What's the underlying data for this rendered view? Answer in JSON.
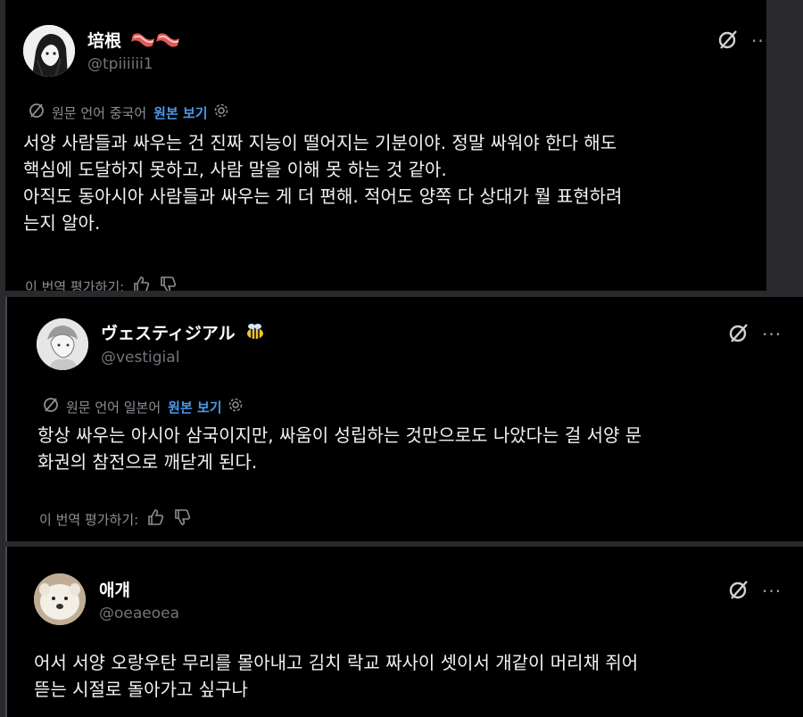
{
  "posts": [
    {
      "author": "培根",
      "handle": "@tpiiiiii1",
      "translation_note": "원문 언어 중국어",
      "view_original": "원본 보기",
      "lines": [
        "서양 사람들과 싸우는 건 진짜 지능이 떨어지는 기분이야. 정말 싸워야 한다 해도",
        "핵심에 도달하지 못하고, 사람 말을 이해 못 하는 것 같아.",
        "아직도 동아시아 사람들과 싸우는 게 더 편해. 적어도 양쪽 다 상대가 뭘 표현하려",
        "는지 알아."
      ],
      "rate_label": "이 번역 평가하기:",
      "emoji": "bacon"
    },
    {
      "author": "ヴェスティジアル",
      "handle": "@vestigial",
      "translation_note": "원문 언어 일본어",
      "view_original": "원본 보기",
      "lines": [
        "항상 싸우는 아시아 삼국이지만, 싸움이 성립하는 것만으로도 나았다는 걸 서양 문",
        "화권의 참전으로 깨닫게 된다."
      ],
      "rate_label": "이 번역 평가하기:",
      "emoji": "bee"
    },
    {
      "author": "애걔",
      "handle": "@oeaeoea",
      "lines": [
        "어서 서양 오랑우탄 무리를 몰아내고 김치 락교 짜사이 셋이서 개같이 머리채 쥐어",
        "뜯는 시절로 돌아가고 싶구나"
      ]
    }
  ],
  "icons": {
    "grok": "grok-icon",
    "more": "more-icon",
    "translate": "translate-icon",
    "settings": "gear-icon",
    "like": "thumbs-up-icon",
    "dislike": "thumbs-down-icon"
  },
  "colors": {
    "link": "#4a99e9",
    "muted": "#71767b",
    "background": "#000000"
  }
}
